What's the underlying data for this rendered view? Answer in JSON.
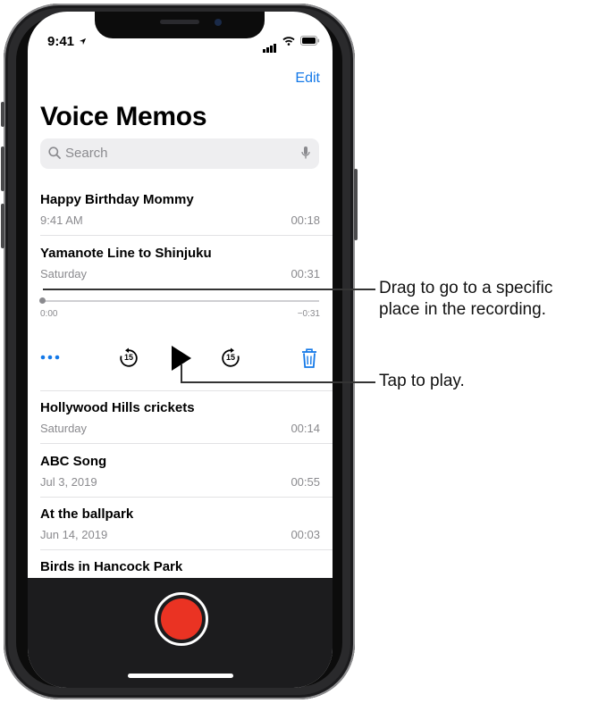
{
  "status_bar": {
    "time": "9:41"
  },
  "header": {
    "edit_label": "Edit",
    "title": "Voice Memos"
  },
  "search": {
    "placeholder": "Search"
  },
  "recordings": [
    {
      "title": "Happy Birthday Mommy",
      "date": "9:41 AM",
      "duration": "00:18"
    },
    {
      "title": "Yamanote Line to Shinjuku",
      "date": "Saturday",
      "duration": "00:31"
    },
    {
      "title": "Hollywood Hills crickets",
      "date": "Saturday",
      "duration": "00:14"
    },
    {
      "title": "ABC Song",
      "date": "Jul 3, 2019",
      "duration": "00:55"
    },
    {
      "title": "At the ballpark",
      "date": "Jun 14, 2019",
      "duration": "00:03"
    },
    {
      "title": "Birds in Hancock Park",
      "date": "",
      "duration": ""
    }
  ],
  "player": {
    "elapsed": "0:00",
    "remaining": "−0:31",
    "progress_fraction": 0.0,
    "skip_back_label": "15",
    "skip_forward_label": "15"
  },
  "callouts": {
    "scrubber_line1": "Drag to go to a specific",
    "scrubber_line2": "place in the recording.",
    "play": "Tap to play."
  },
  "colors": {
    "accent": "#1479e8",
    "record": "#ea3323",
    "bottom_bar": "#1c1c1e"
  },
  "icons": [
    "location-arrow-icon",
    "signal-icon",
    "wifi-icon",
    "battery-icon",
    "search-icon",
    "microphone-icon",
    "more-icon",
    "skip-back-15-icon",
    "play-icon",
    "skip-forward-15-icon",
    "trash-icon",
    "record-icon"
  ]
}
